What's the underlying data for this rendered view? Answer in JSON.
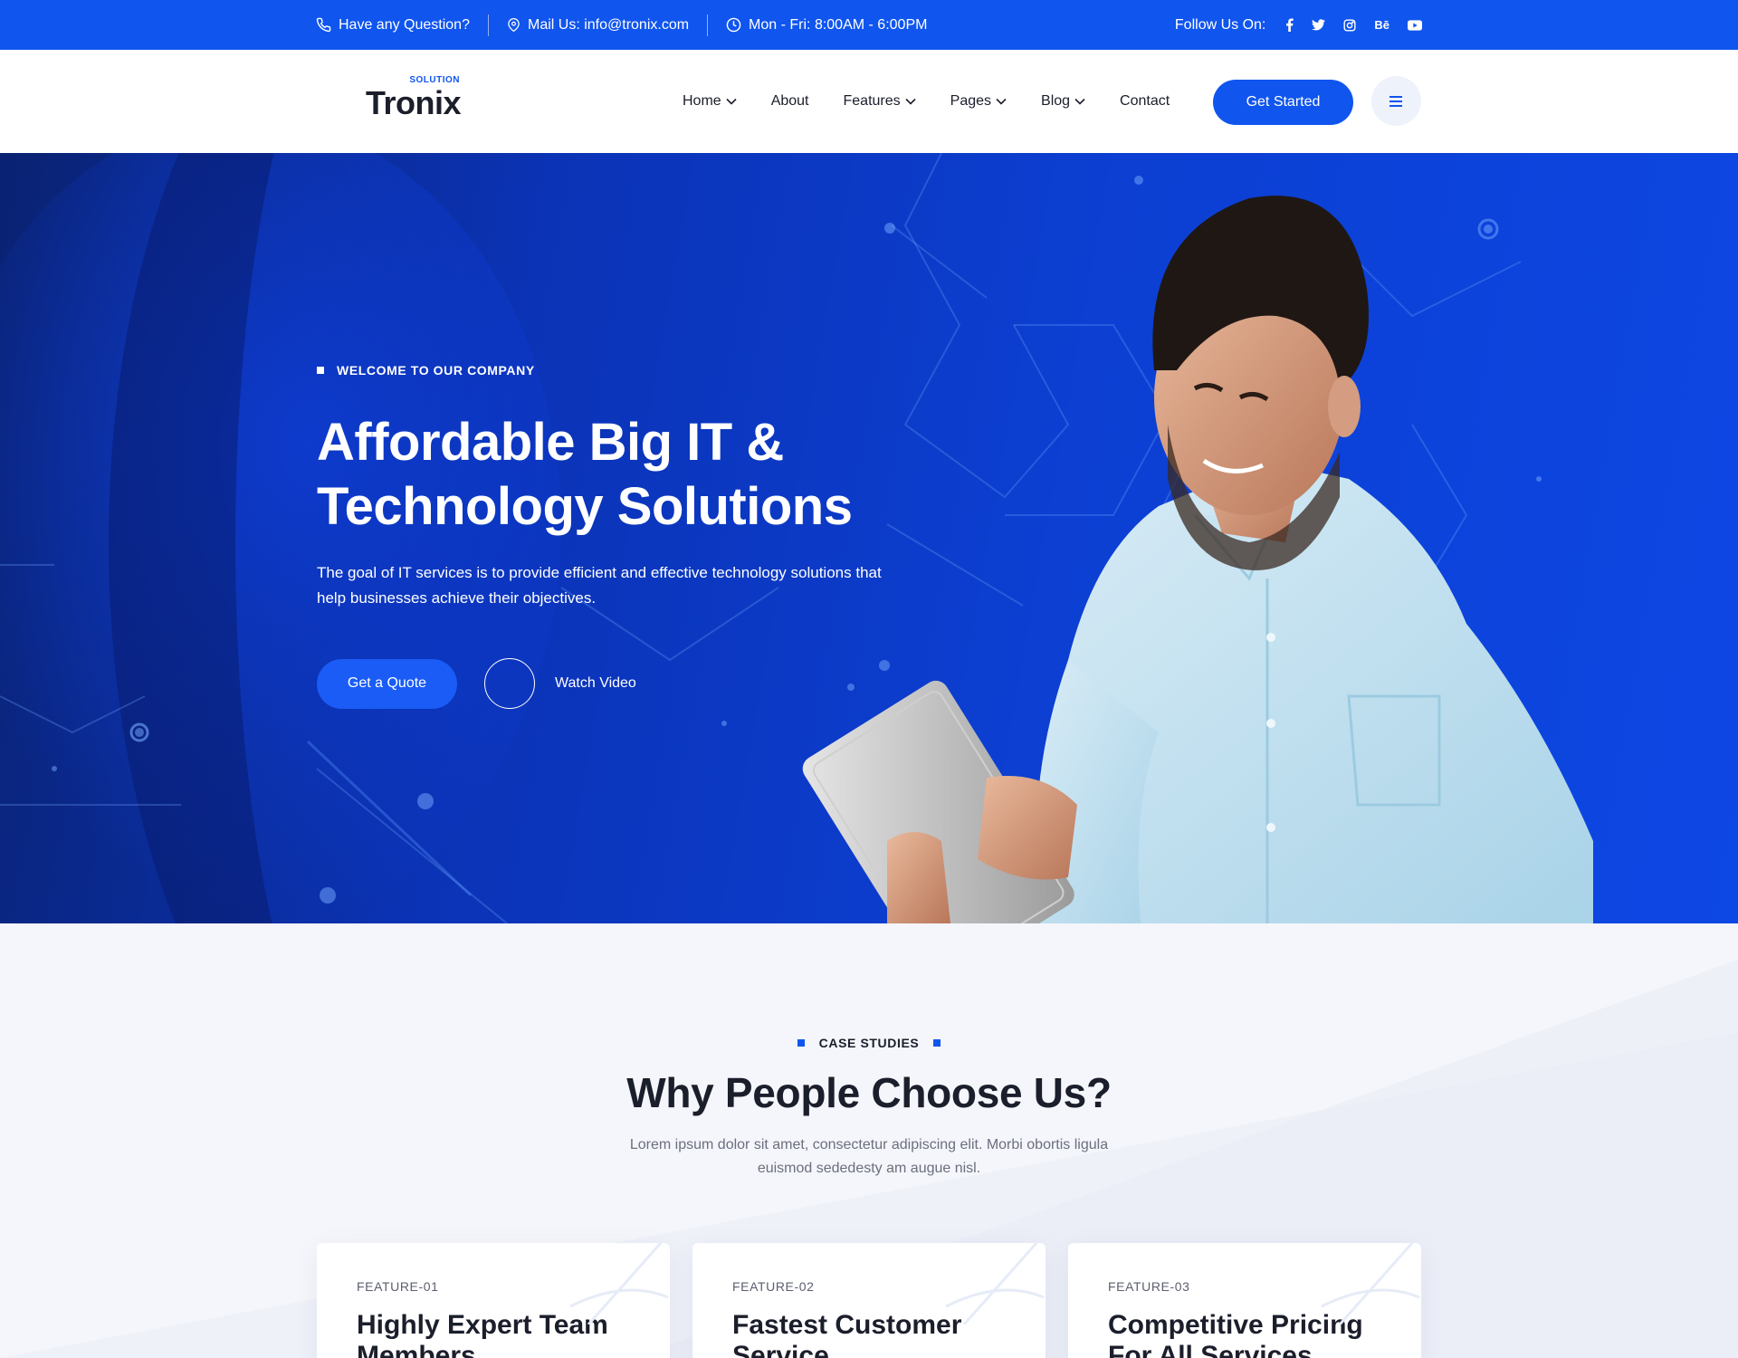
{
  "topbar": {
    "question": "Have any Question?",
    "mail": "Mail Us: info@tronix.com",
    "hours": "Mon - Fri: 8:00AM - 6:00PM",
    "follow": "Follow Us On:",
    "social": [
      "facebook-icon",
      "twitter-icon",
      "instagram-icon",
      "behance-icon",
      "youtube-icon"
    ],
    "behance_text": "Bē"
  },
  "header": {
    "logo_small": "SOLUTION",
    "logo_main": "Tronix",
    "nav": [
      {
        "label": "Home",
        "dropdown": true
      },
      {
        "label": "About",
        "dropdown": false
      },
      {
        "label": "Features",
        "dropdown": true
      },
      {
        "label": "Pages",
        "dropdown": true
      },
      {
        "label": "Blog",
        "dropdown": true
      },
      {
        "label": "Contact",
        "dropdown": false
      }
    ],
    "cta": "Get Started"
  },
  "hero": {
    "eyebrow": "WELCOME TO OUR COMPANY",
    "title_line1": "Affordable Big IT &",
    "title_line2": "Technology Solutions",
    "desc": "The goal of IT services is to provide efficient and effective technology solutions that help businesses achieve their objectives.",
    "quote_btn": "Get a Quote",
    "watch": "Watch Video"
  },
  "why": {
    "label": "CASE STUDIES",
    "title": "Why People Choose Us?",
    "desc": "Lorem ipsum dolor sit amet, consectetur adipiscing elit. Morbi obortis ligula euismod sededesty am augue nisl.",
    "cards": [
      {
        "tag": "FEATURE-01",
        "title": "Highly Expert Team Members"
      },
      {
        "tag": "FEATURE-02",
        "title": "Fastest Customer Service"
      },
      {
        "tag": "FEATURE-03",
        "title": "Competitive Pricing For All Services"
      }
    ]
  },
  "colors": {
    "primary": "#1055ee",
    "dark": "#1b1e2b",
    "hero_bg": "#0c3fd2"
  }
}
